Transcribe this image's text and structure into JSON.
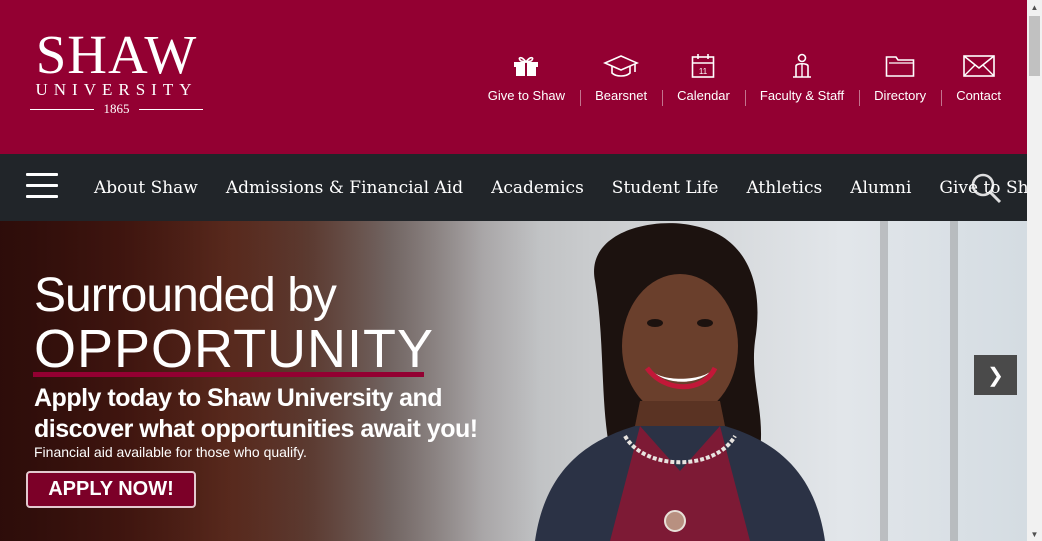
{
  "logo": {
    "name": "SHAW",
    "subtitle": "UNIVERSITY",
    "year": "1865"
  },
  "utility": [
    {
      "label": "Give to Shaw",
      "icon": "gift-icon"
    },
    {
      "label": "Bearsnet",
      "icon": "graduation-cap-icon"
    },
    {
      "label": "Calendar",
      "icon": "calendar-icon",
      "day": "11"
    },
    {
      "label": "Faculty & Staff",
      "icon": "person-icon"
    },
    {
      "label": "Directory",
      "icon": "folder-icon"
    },
    {
      "label": "Contact",
      "icon": "envelope-icon"
    }
  ],
  "nav": {
    "items": [
      "About Shaw",
      "Admissions & Financial Aid",
      "Academics",
      "Student Life",
      "Athletics",
      "Alumni",
      "Give to Shaw"
    ]
  },
  "hero": {
    "line1": "Surrounded by",
    "line2": "OPPORTUNITY",
    "subhead": "Apply today to Shaw University and discover what opportunities await you!",
    "note": "Financial aid available for those who qualify.",
    "button": "APPLY NOW!",
    "next": "❯"
  },
  "colors": {
    "brand": "#930032",
    "nav_bg": "#212529"
  }
}
